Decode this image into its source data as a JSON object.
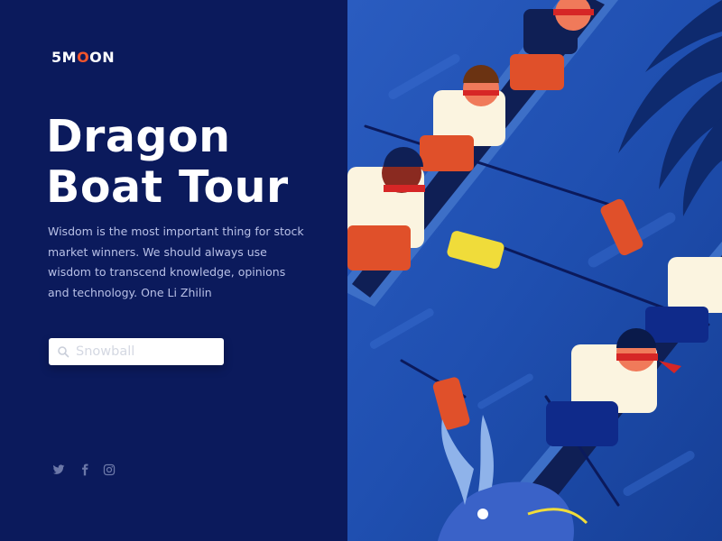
{
  "brand": {
    "logo_prefix": "5M",
    "logo_accent": "O",
    "logo_suffix": "ON",
    "accent_color": "#f2552c"
  },
  "hero": {
    "title_line1": "Dragon",
    "title_line2": "Boat Tour",
    "description": "Wisdom is the most important thing for stock market winners. We should always use wisdom to transcend knowledge, opinions and technology. One Li Zhilin"
  },
  "search": {
    "placeholder": "Snowball",
    "value": "",
    "icon": "search-icon"
  },
  "social": {
    "icons": [
      "twitter-icon",
      "facebook-icon",
      "instagram-icon"
    ]
  },
  "colors": {
    "panel_bg": "#0b1a5c",
    "water": "#1f4fb0",
    "boat": "#12245e",
    "oar_red": "#e0502a",
    "oar_yellow": "#f0dc3a"
  }
}
